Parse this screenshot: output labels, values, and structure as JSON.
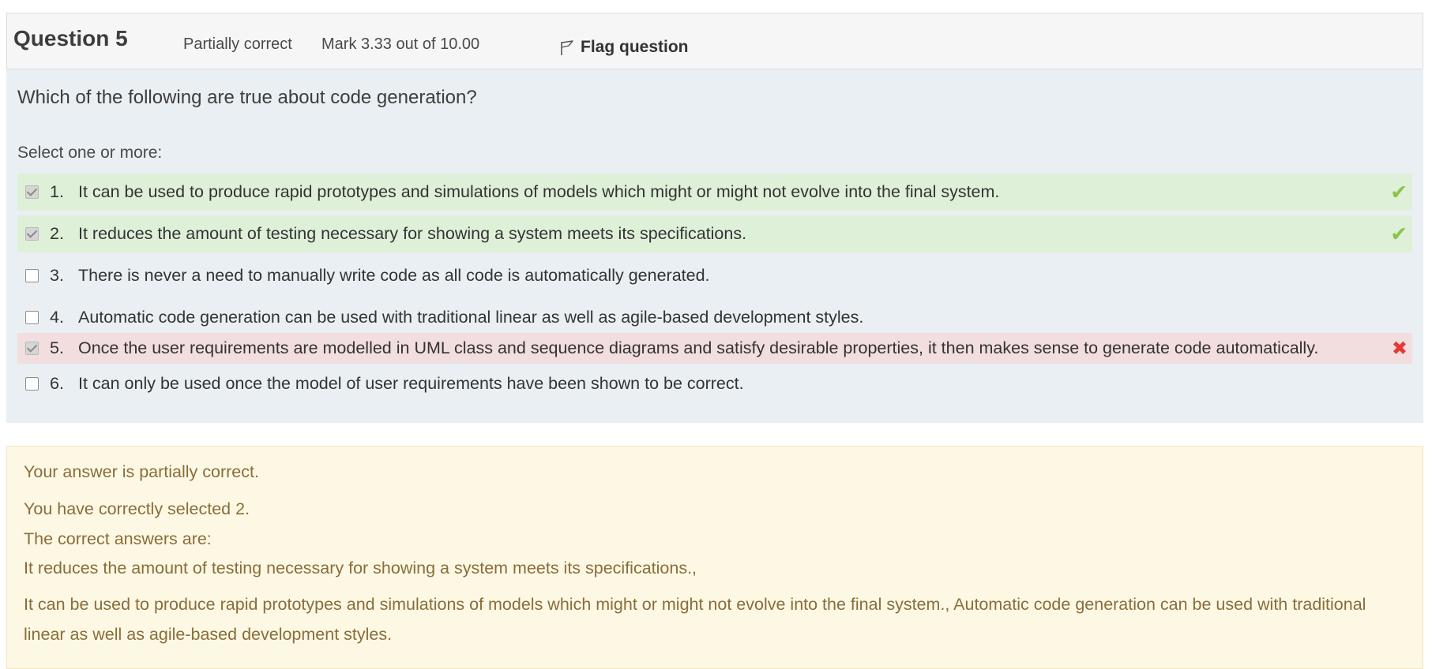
{
  "header": {
    "title": "Question 5",
    "state": "Partially correct",
    "mark": "Mark 3.33 out of 10.00",
    "flag_label": "Flag question",
    "flag_icon": "flag-icon"
  },
  "question": {
    "text": "Which of the following are true about code generation?",
    "prompt": "Select one or more:",
    "options": [
      {
        "number": "1.",
        "text": "It can be used to produce rapid prototypes and simulations of models which might or might not evolve into the final system.",
        "checked": true,
        "result": "correct"
      },
      {
        "number": "2.",
        "text": "It reduces the amount of testing necessary for showing a system meets its specifications.",
        "checked": true,
        "result": "correct"
      },
      {
        "number": "3.",
        "text": "There is never a need to manually write code as all code is automatically generated.",
        "checked": false,
        "result": "none"
      },
      {
        "number": "4.",
        "text": "Automatic code generation can be used with traditional linear as well as agile-based development styles.",
        "checked": false,
        "result": "none"
      },
      {
        "number": "5.",
        "text": "Once the user requirements are modelled in UML class and sequence diagrams and satisfy desirable properties, it then makes sense to generate code automatically.",
        "checked": true,
        "result": "incorrect"
      },
      {
        "number": "6.",
        "text": "It can only be used once the model of user requirements have been shown to be correct.",
        "checked": false,
        "result": "none"
      }
    ],
    "correct_color": "#dff0d8",
    "incorrect_color": "#f2dede",
    "check_icon": "check-icon",
    "cross_icon": "cross-icon"
  },
  "feedback": {
    "line1": "Your answer is partially correct.",
    "line2": "You have correctly selected 2.",
    "line3": "The correct answers are:",
    "line4": "It reduces the amount of testing necessary for showing a system meets its specifications.,",
    "line5": "It can be used to produce rapid prototypes and simulations of models which might or might not evolve into the final system., Automatic code generation can be used with traditional linear as well as agile-based development styles.",
    "color": "#8a6d3b",
    "background": "#fcf8e3"
  }
}
